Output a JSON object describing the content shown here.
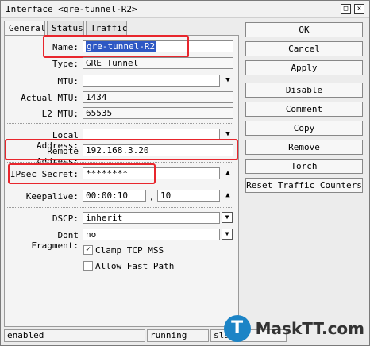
{
  "window": {
    "title": "Interface <gre-tunnel-R2>",
    "restore_icon": "restore-icon",
    "close_icon": "close-icon"
  },
  "tabs": [
    {
      "label": "General"
    },
    {
      "label": "Status"
    },
    {
      "label": "Traffic"
    }
  ],
  "form": {
    "name": {
      "label": "Name:",
      "value": "gre-tunnel-R2"
    },
    "type": {
      "label": "Type:",
      "value": "GRE Tunnel"
    },
    "mtu": {
      "label": "MTU:",
      "value": ""
    },
    "actual_mtu": {
      "label": "Actual MTU:",
      "value": "1434"
    },
    "l2_mtu": {
      "label": "L2 MTU:",
      "value": "65535"
    },
    "local_address": {
      "label": "Local Address:",
      "value": ""
    },
    "remote_address": {
      "label": "Remote Address:",
      "value": "192.168.3.20"
    },
    "ipsec_secret": {
      "label": "IPsec Secret:",
      "value": "********"
    },
    "keepalive": {
      "label": "Keepalive:",
      "interval": "00:00:10",
      "separator": ",",
      "retries": "10"
    },
    "dscp": {
      "label": "DSCP:",
      "value": "inherit"
    },
    "dont_fragment": {
      "label": "Dont Fragment:",
      "value": "no"
    },
    "clamp_tcp_mss": {
      "label": "Clamp TCP MSS",
      "checked": true
    },
    "allow_fast_path": {
      "label": "Allow Fast Path",
      "checked": false
    }
  },
  "buttons": {
    "ok": "OK",
    "cancel": "Cancel",
    "apply": "Apply",
    "disable": "Disable",
    "comment": "Comment",
    "copy": "Copy",
    "remove": "Remove",
    "torch": "Torch",
    "reset_traffic": "Reset Traffic Counters"
  },
  "statusbar": {
    "state": "enabled",
    "running": "running",
    "slave": "slave"
  },
  "watermark": {
    "logo_letter": "T",
    "text": "MaskTT.com"
  },
  "colors": {
    "highlight": "#e8262d",
    "selection": "#2e58c4"
  }
}
